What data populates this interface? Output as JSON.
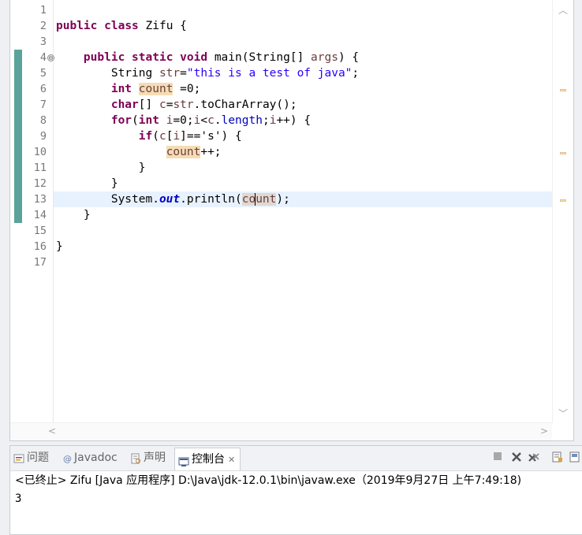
{
  "editor": {
    "line_numbers": [
      "1",
      "2",
      "3",
      "4",
      "5",
      "6",
      "7",
      "8",
      "9",
      "10",
      "11",
      "12",
      "13",
      "14",
      "15",
      "16",
      "17"
    ],
    "lines": [
      [],
      [
        {
          "t": "public",
          "c": "kw"
        },
        {
          "t": " "
        },
        {
          "t": "class",
          "c": "kw"
        },
        {
          "t": " Zifu {"
        }
      ],
      [],
      [
        {
          "t": "    "
        },
        {
          "t": "public",
          "c": "kw"
        },
        {
          "t": " "
        },
        {
          "t": "static",
          "c": "kw"
        },
        {
          "t": " "
        },
        {
          "t": "void",
          "c": "kw"
        },
        {
          "t": " main(String[] "
        },
        {
          "t": "args",
          "c": "var"
        },
        {
          "t": ") {"
        }
      ],
      [
        {
          "t": "        String "
        },
        {
          "t": "str",
          "c": "var"
        },
        {
          "t": "="
        },
        {
          "t": "\"this is a test of java\"",
          "c": "str"
        },
        {
          "t": ";"
        }
      ],
      [
        {
          "t": "        "
        },
        {
          "t": "int",
          "c": "kw"
        },
        {
          "t": " "
        },
        {
          "t": "count",
          "c": "var occ"
        },
        {
          "t": " =0;"
        }
      ],
      [
        {
          "t": "        "
        },
        {
          "t": "char",
          "c": "kw"
        },
        {
          "t": "[] "
        },
        {
          "t": "c",
          "c": "var"
        },
        {
          "t": "="
        },
        {
          "t": "str",
          "c": "var"
        },
        {
          "t": ".toCharArray();"
        }
      ],
      [
        {
          "t": "        "
        },
        {
          "t": "for",
          "c": "kw"
        },
        {
          "t": "("
        },
        {
          "t": "int",
          "c": "kw"
        },
        {
          "t": " "
        },
        {
          "t": "i",
          "c": "var"
        },
        {
          "t": "=0;"
        },
        {
          "t": "i",
          "c": "var"
        },
        {
          "t": "<"
        },
        {
          "t": "c",
          "c": "var"
        },
        {
          "t": "."
        },
        {
          "t": "length",
          "c": "fld2"
        },
        {
          "t": ";"
        },
        {
          "t": "i",
          "c": "var"
        },
        {
          "t": "++) {"
        }
      ],
      [
        {
          "t": "            "
        },
        {
          "t": "if",
          "c": "kw"
        },
        {
          "t": "("
        },
        {
          "t": "c",
          "c": "var"
        },
        {
          "t": "["
        },
        {
          "t": "i",
          "c": "var"
        },
        {
          "t": "]=='s') {"
        }
      ],
      [
        {
          "t": "                "
        },
        {
          "t": "count",
          "c": "var occ"
        },
        {
          "t": "++;"
        }
      ],
      [
        {
          "t": "            }"
        }
      ],
      [
        {
          "t": "        }"
        }
      ],
      [
        {
          "t": "        System."
        },
        {
          "t": "out",
          "c": "fld"
        },
        {
          "t": ".println("
        },
        {
          "t": "co",
          "c": "var occ2"
        },
        {
          "t": "unt",
          "c": "var occ2 caret"
        },
        {
          "t": ");"
        }
      ],
      [
        {
          "t": "    }"
        }
      ],
      [],
      [
        {
          "t": "}"
        }
      ],
      []
    ],
    "fold_marker": "⊖",
    "scroll_up": "︿",
    "scroll_down": "﹀",
    "scroll_left": "<",
    "scroll_right": ">"
  },
  "console": {
    "tabs": [
      {
        "label": "问题",
        "icon": "problems-icon",
        "active": false
      },
      {
        "label": "Javadoc",
        "icon": "javadoc-icon",
        "active": false
      },
      {
        "label": "声明",
        "icon": "declaration-icon",
        "active": false
      },
      {
        "label": "控制台",
        "icon": "console-icon",
        "active": true
      }
    ],
    "close_glyph": "✕",
    "description": "<已终止> Zifu [Java 应用程序] D:\\Java\\jdk-12.0.1\\bin\\javaw.exe（2019年9月27日 上午7:49:18)",
    "output": "3",
    "tool_icons": [
      "terminate-icon",
      "remove-launch-icon",
      "remove-all-terminated-icon",
      "scroll-lock-icon",
      "pin-console-icon"
    ]
  },
  "colors": {
    "keyword": "#7f0055",
    "string": "#2a00ff",
    "local_var": "#6a3e3e",
    "field": "#0000c0",
    "occurrence_bg": "#f6dcb4",
    "current_line_bg": "#e8f2fe",
    "change_bar": "#5aa39a"
  }
}
